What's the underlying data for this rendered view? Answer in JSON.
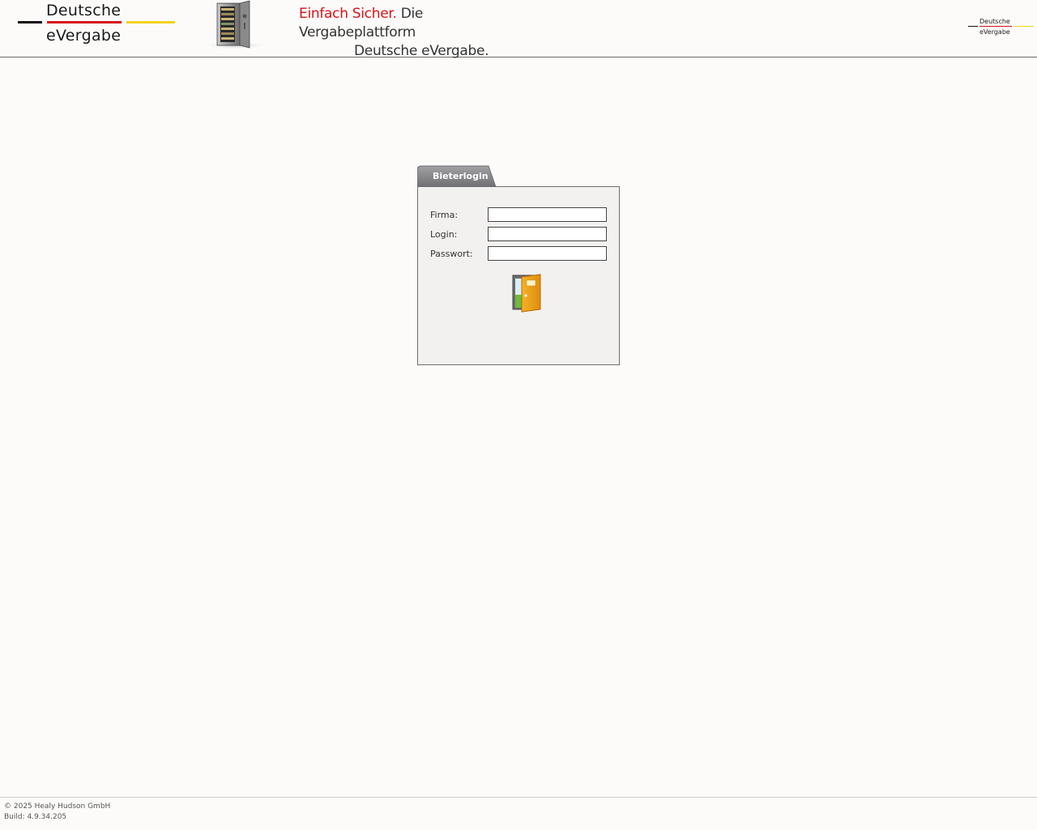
{
  "header": {
    "logo": {
      "line1": "Deutsche",
      "line2": "eVergabe"
    },
    "slogan": {
      "highlight": "Einfach Sicher.",
      "rest": "Die Vergabeplattform",
      "line2": "Deutsche eVergabe."
    },
    "small_logo": {
      "line1": "Deutsche",
      "line2": "eVergabe"
    },
    "safe_icon": "safe-icon"
  },
  "login": {
    "tab_label": "Bieterlogin",
    "fields": {
      "firma": {
        "label": "Firma:",
        "value": "",
        "placeholder": ""
      },
      "login": {
        "label": "Login:",
        "value": "",
        "placeholder": ""
      },
      "passwort": {
        "label": "Passwort:",
        "value": "",
        "placeholder": ""
      }
    },
    "submit_icon": "door-icon"
  },
  "footer": {
    "copyright": "© 2025 Healy Hudson GmbH",
    "build": "Build: 4.9.34.205"
  },
  "colors": {
    "brand_red": "#d9131a",
    "brand_gold": "#f2d21f",
    "tab_gray": "#7d7c80",
    "panel_bg": "#f2f1f0"
  }
}
